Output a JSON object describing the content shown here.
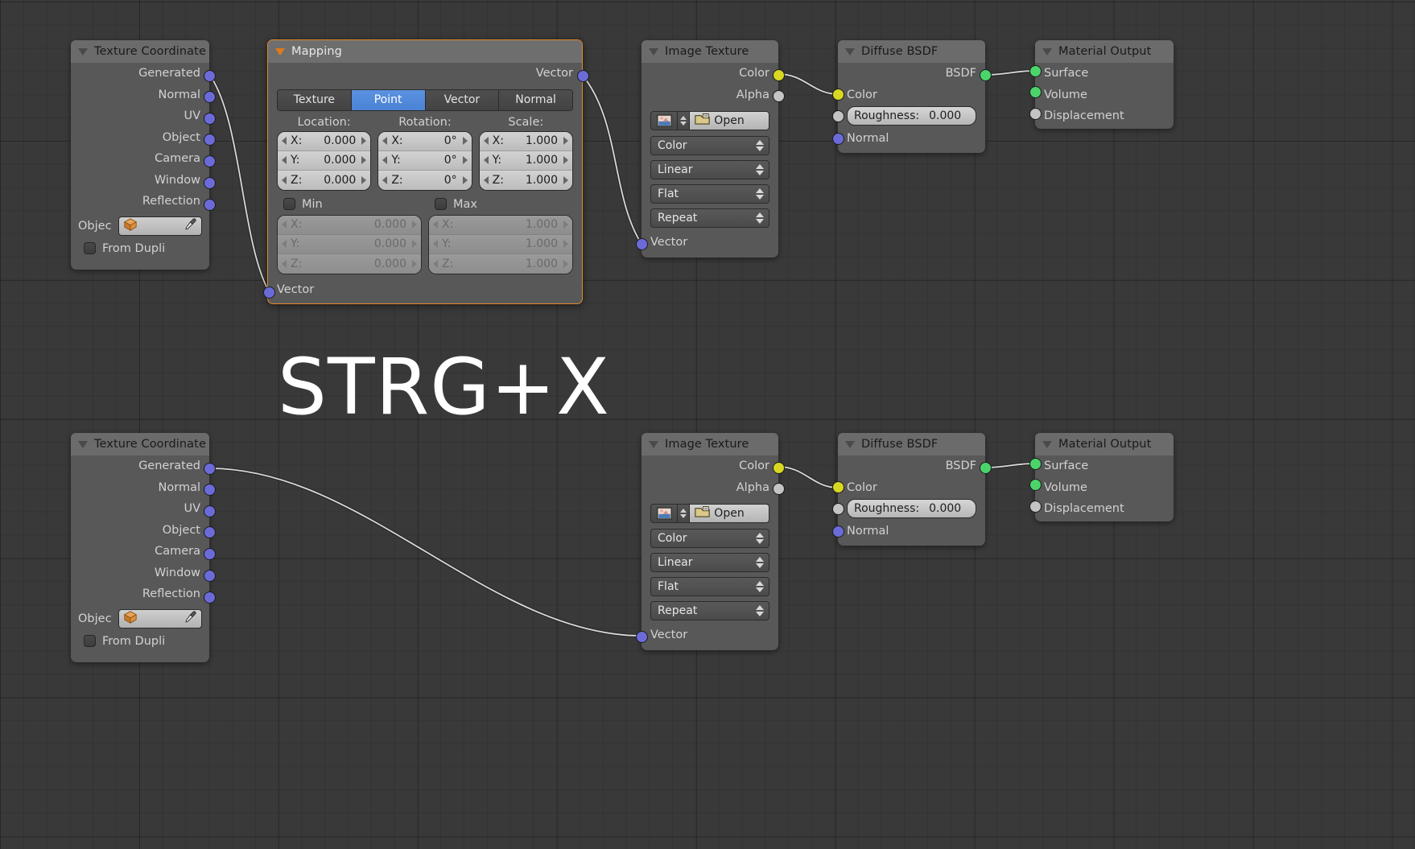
{
  "editor": {
    "background_color": "#393939",
    "grid_color": "#2f2f2f",
    "overlay_text": "STRG+X"
  },
  "socket_colors": {
    "vector": "#6b6bd8",
    "color": "#d8d823",
    "shader": "#4ad46a",
    "unconnected": "#c4c4c4",
    "selected_outline": "#e08a28"
  },
  "nodes": {
    "texcoord_top": {
      "title": "Texture Coordinate",
      "outputs": [
        "Generated",
        "Normal",
        "UV",
        "Object",
        "Camera",
        "Window",
        "Reflection"
      ],
      "object_label": "Objec",
      "object_icon": "cube-icon",
      "eyedropper_icon": "eyedropper-icon",
      "from_dupli_label": "From Dupli"
    },
    "mapping": {
      "title": "Mapping",
      "output_label": "Vector",
      "input_label": "Vector",
      "tabs": [
        "Texture",
        "Point",
        "Vector",
        "Normal"
      ],
      "active_tab": "Point",
      "columns": [
        {
          "label": "Location:",
          "rows": [
            {
              "axis": "X:",
              "value": "0.000"
            },
            {
              "axis": "Y:",
              "value": "0.000"
            },
            {
              "axis": "Z:",
              "value": "0.000"
            }
          ]
        },
        {
          "label": "Rotation:",
          "rows": [
            {
              "axis": "X:",
              "value": "0°"
            },
            {
              "axis": "Y:",
              "value": "0°"
            },
            {
              "axis": "Z:",
              "value": "0°"
            }
          ]
        },
        {
          "label": "Scale:",
          "rows": [
            {
              "axis": "X:",
              "value": "1.000"
            },
            {
              "axis": "Y:",
              "value": "1.000"
            },
            {
              "axis": "Z:",
              "value": "1.000"
            }
          ]
        }
      ],
      "min": {
        "label": "Min",
        "checked": false,
        "rows": [
          {
            "axis": "X:",
            "value": "0.000"
          },
          {
            "axis": "Y:",
            "value": "0.000"
          },
          {
            "axis": "Z:",
            "value": "0.000"
          }
        ]
      },
      "max": {
        "label": "Max",
        "checked": false,
        "rows": [
          {
            "axis": "X:",
            "value": "1.000"
          },
          {
            "axis": "Y:",
            "value": "1.000"
          },
          {
            "axis": "Z:",
            "value": "1.000"
          }
        ]
      }
    },
    "imagetex_top": {
      "title": "Image Texture",
      "outputs": [
        "Color",
        "Alpha"
      ],
      "image_icon": "image-icon",
      "open_label": "Open",
      "folder_icon": "folder-icon",
      "dropdowns": [
        "Color",
        "Linear",
        "Flat",
        "Repeat"
      ],
      "input_label": "Vector"
    },
    "diffuse_top": {
      "title": "Diffuse BSDF",
      "output_label": "BSDF",
      "inputs": [
        "Color",
        "Normal"
      ],
      "roughness_label": "Roughness:",
      "roughness_value": "0.000"
    },
    "matout_top": {
      "title": "Material Output",
      "inputs": [
        "Surface",
        "Volume",
        "Displacement"
      ]
    },
    "texcoord_bottom": {
      "title": "Texture Coordinate",
      "outputs": [
        "Generated",
        "Normal",
        "UV",
        "Object",
        "Camera",
        "Window",
        "Reflection"
      ],
      "object_label": "Objec",
      "object_icon": "cube-icon",
      "eyedropper_icon": "eyedropper-icon",
      "from_dupli_label": "From Dupli"
    },
    "imagetex_bottom": {
      "title": "Image Texture",
      "outputs": [
        "Color",
        "Alpha"
      ],
      "image_icon": "image-icon",
      "open_label": "Open",
      "folder_icon": "folder-icon",
      "dropdowns": [
        "Color",
        "Linear",
        "Flat",
        "Repeat"
      ],
      "input_label": "Vector"
    },
    "diffuse_bottom": {
      "title": "Diffuse BSDF",
      "output_label": "BSDF",
      "inputs": [
        "Color",
        "Normal"
      ],
      "roughness_label": "Roughness:",
      "roughness_value": "0.000"
    },
    "matout_bottom": {
      "title": "Material Output",
      "inputs": [
        "Surface",
        "Volume",
        "Displacement"
      ]
    }
  }
}
